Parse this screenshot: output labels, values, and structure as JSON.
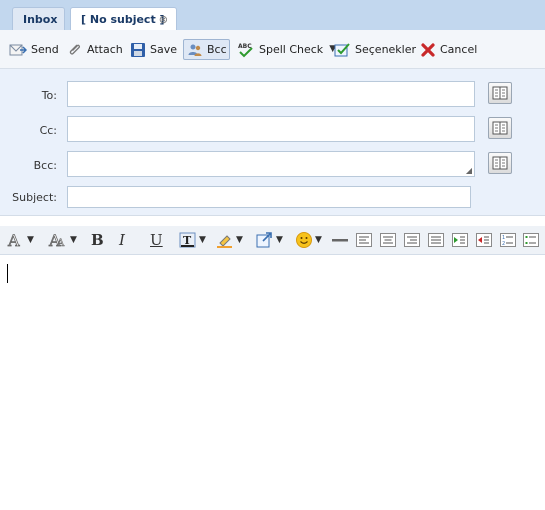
{
  "tabs": [
    {
      "label": "Inbox"
    },
    {
      "label": "[ No subject ]"
    }
  ],
  "toolbar": {
    "send": "Send",
    "attach": "Attach",
    "save": "Save",
    "bcc": "Bcc",
    "spell_check": "Spell Check",
    "options": "Seçenekler",
    "cancel": "Cancel"
  },
  "form": {
    "to_label": "To:",
    "cc_label": "Cc:",
    "bcc_label": "Bcc:",
    "subject_label": "Subject:",
    "to_value": "",
    "cc_value": "",
    "bcc_value": "",
    "subject_value": ""
  },
  "format": {
    "bold": "B",
    "italic": "I",
    "underline": "U"
  },
  "colors": {
    "tabbar": "#c2d7ee",
    "form_bg": "#eaf1fb",
    "accent": "#1a3a66"
  }
}
